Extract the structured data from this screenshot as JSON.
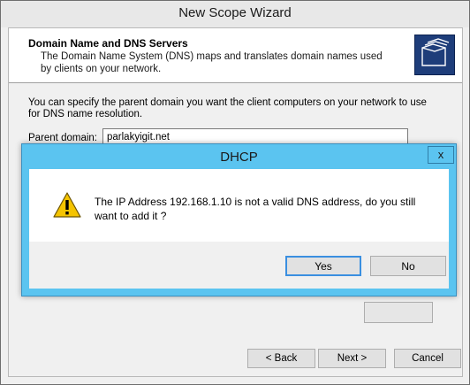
{
  "wizard": {
    "title": "New Scope Wizard",
    "header": {
      "title": "Domain Name and DNS Servers",
      "description": "The Domain Name System (DNS) maps and translates domain names used by clients on your network."
    },
    "intro_text": "You can specify the parent domain you want the client computers on your network to use for DNS name resolution.",
    "parent_domain": {
      "label": "Parent domain:",
      "value": "parlakyigit.net"
    },
    "buttons": {
      "back": "< Back",
      "next": "Next >",
      "cancel": "Cancel"
    },
    "header_icon": "folder-stack-icon"
  },
  "dialog": {
    "title": "DHCP",
    "close_label": "x",
    "message": "The IP Address 192.168.1.10 is not a valid DNS address, do you still want to add it ?",
    "icon": "warning-icon",
    "buttons": {
      "yes": "Yes",
      "no": "No"
    },
    "accent_color": "#5bc4f0"
  }
}
